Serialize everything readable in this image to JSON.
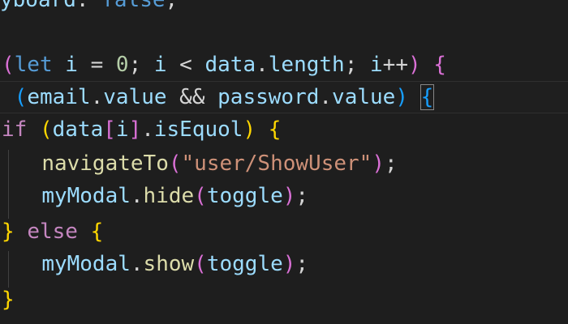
{
  "editor": {
    "lines": [
      {
        "tokens": [
          {
            "t": "yboard",
            "c": "var"
          },
          {
            "t": ": ",
            "c": "plain"
          },
          {
            "t": "false",
            "c": "kw-blue"
          },
          {
            "t": ";",
            "c": "plain"
          }
        ]
      },
      {
        "tokens": []
      },
      {
        "tokens": [
          {
            "t": "(",
            "c": "brace-pink"
          },
          {
            "t": "let",
            "c": "kw-blue"
          },
          {
            "t": " ",
            "c": "plain"
          },
          {
            "t": "i",
            "c": "var"
          },
          {
            "t": " = ",
            "c": "plain"
          },
          {
            "t": "0",
            "c": "num"
          },
          {
            "t": "; ",
            "c": "plain"
          },
          {
            "t": "i",
            "c": "var"
          },
          {
            "t": " < ",
            "c": "plain"
          },
          {
            "t": "data",
            "c": "var"
          },
          {
            "t": ".",
            "c": "plain"
          },
          {
            "t": "length",
            "c": "var"
          },
          {
            "t": "; ",
            "c": "plain"
          },
          {
            "t": "i",
            "c": "var"
          },
          {
            "t": "++",
            "c": "plain"
          },
          {
            "t": ") ",
            "c": "brace-pink"
          },
          {
            "t": "{",
            "c": "brace-pink"
          }
        ]
      },
      {
        "tokens": [
          {
            "t": " (",
            "c": "brace-blue"
          },
          {
            "t": "email",
            "c": "var"
          },
          {
            "t": ".",
            "c": "plain"
          },
          {
            "t": "value",
            "c": "var"
          },
          {
            "t": " && ",
            "c": "plain"
          },
          {
            "t": "password",
            "c": "var"
          },
          {
            "t": ".",
            "c": "plain"
          },
          {
            "t": "value",
            "c": "var"
          },
          {
            "t": ") ",
            "c": "brace-blue"
          },
          {
            "t": "{",
            "c": "brace-blue",
            "match": true
          }
        ]
      },
      {
        "tokens": [
          {
            "t": "if",
            "c": "kw-purple"
          },
          {
            "t": " (",
            "c": "brace-gold"
          },
          {
            "t": "data",
            "c": "var"
          },
          {
            "t": "[",
            "c": "brace-pink"
          },
          {
            "t": "i",
            "c": "var"
          },
          {
            "t": "]",
            "c": "brace-pink"
          },
          {
            "t": ".",
            "c": "plain"
          },
          {
            "t": "isEquol",
            "c": "var"
          },
          {
            "t": ") ",
            "c": "brace-gold"
          },
          {
            "t": "{",
            "c": "brace-gold"
          }
        ]
      },
      {
        "tokens": [
          {
            "t": "  ",
            "c": "plain"
          },
          {
            "t": "navigateTo",
            "c": "fn"
          },
          {
            "t": "(",
            "c": "brace-pink"
          },
          {
            "t": "\"user/ShowUser\"",
            "c": "str"
          },
          {
            "t": ")",
            "c": "brace-pink"
          },
          {
            "t": ";",
            "c": "plain"
          }
        ]
      },
      {
        "tokens": [
          {
            "t": "  ",
            "c": "plain"
          },
          {
            "t": "myModal",
            "c": "var"
          },
          {
            "t": ".",
            "c": "plain"
          },
          {
            "t": "hide",
            "c": "fn"
          },
          {
            "t": "(",
            "c": "brace-pink"
          },
          {
            "t": "toggle",
            "c": "var"
          },
          {
            "t": ")",
            "c": "brace-pink"
          },
          {
            "t": ";",
            "c": "plain"
          }
        ]
      },
      {
        "tokens": [
          {
            "t": "}",
            "c": "brace-gold"
          },
          {
            "t": " ",
            "c": "plain"
          },
          {
            "t": "else",
            "c": "kw-purple"
          },
          {
            "t": " ",
            "c": "plain"
          },
          {
            "t": "{",
            "c": "brace-gold"
          }
        ]
      },
      {
        "tokens": [
          {
            "t": "  ",
            "c": "plain"
          },
          {
            "t": "myModal",
            "c": "var"
          },
          {
            "t": ".",
            "c": "plain"
          },
          {
            "t": "show",
            "c": "fn"
          },
          {
            "t": "(",
            "c": "brace-pink"
          },
          {
            "t": "toggle",
            "c": "var"
          },
          {
            "t": ")",
            "c": "brace-pink"
          },
          {
            "t": ";",
            "c": "plain"
          }
        ]
      },
      {
        "tokens": [
          {
            "t": "}",
            "c": "brace-gold"
          }
        ]
      }
    ]
  },
  "colors": {
    "background": "#1e1e1e",
    "keyword": "#569cd6",
    "control_keyword": "#c586c0",
    "variable": "#9cdcfe",
    "function": "#dcdcaa",
    "string": "#ce9178",
    "number": "#b5cea8"
  }
}
